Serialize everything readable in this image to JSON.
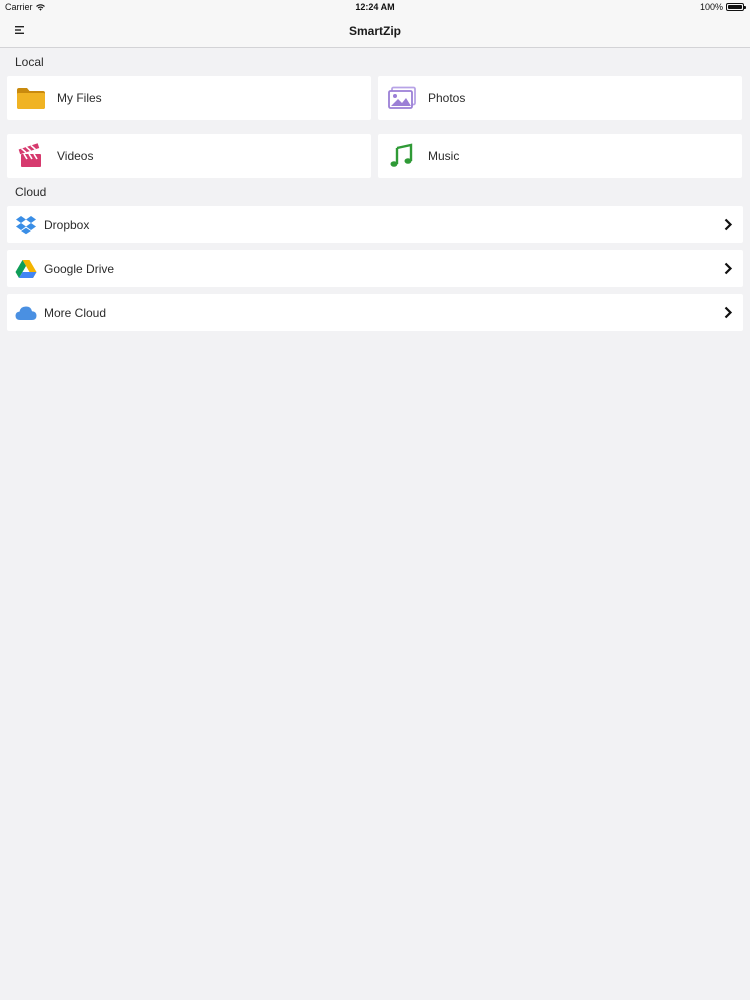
{
  "status": {
    "carrier": "Carrier",
    "time": "12:24 AM",
    "battery": "100%",
    "battery_level": 1.0
  },
  "nav": {
    "title": "SmartZip",
    "menu_icon": "menu-lines-icon"
  },
  "local": {
    "header": "Local",
    "items": [
      {
        "label": "My Files",
        "icon": "folder-icon",
        "color": "#e8a51c"
      },
      {
        "label": "Photos",
        "icon": "photos-icon",
        "color": "#9b7fd6"
      },
      {
        "label": "Videos",
        "icon": "clapperboard-icon",
        "color": "#d63a6e"
      },
      {
        "label": "Music",
        "icon": "music-note-icon",
        "color": "#2f9a36"
      }
    ]
  },
  "cloud": {
    "header": "Cloud",
    "items": [
      {
        "label": "Dropbox",
        "icon": "dropbox-icon",
        "color": "#3a8ee6"
      },
      {
        "label": "Google Drive",
        "icon": "google-drive-icon",
        "color": "#1fa463"
      },
      {
        "label": "More Cloud",
        "icon": "cloud-icon",
        "color": "#4a90e2"
      }
    ]
  }
}
